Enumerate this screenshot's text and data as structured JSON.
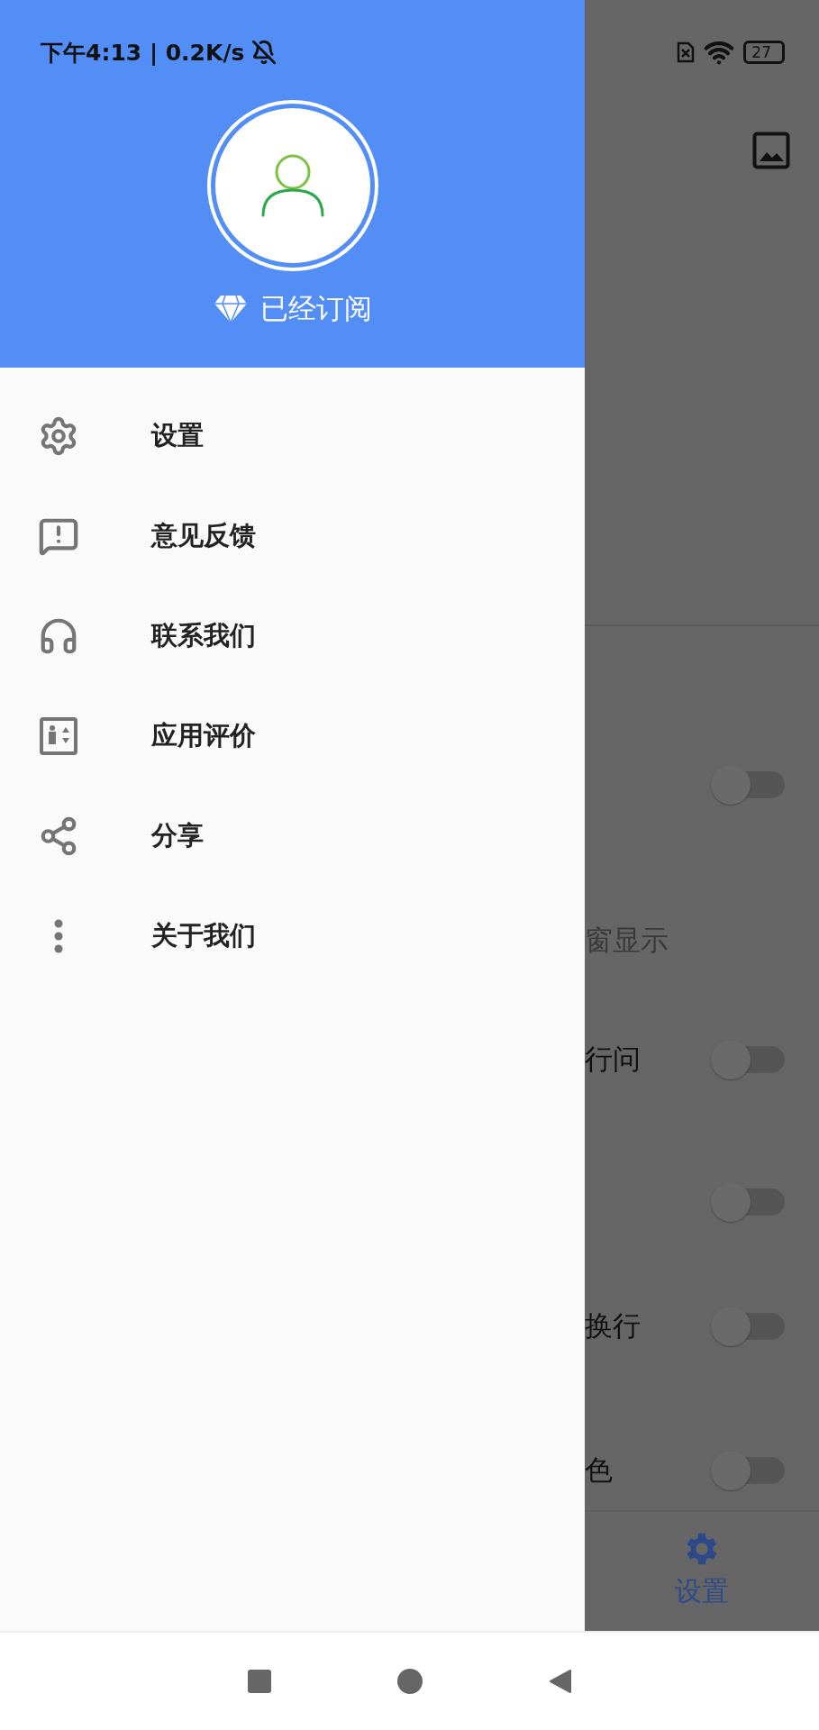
{
  "status_bar": {
    "time_and_speed": "下午4:13 | 0.2K/s",
    "battery": "27"
  },
  "drawer": {
    "subscription": "已经订阅",
    "items": [
      {
        "kind": "settings",
        "label": "设置"
      },
      {
        "kind": "feedback",
        "label": "意见反馈"
      },
      {
        "kind": "contact",
        "label": "联系我们"
      },
      {
        "kind": "rate",
        "label": "应用评价"
      },
      {
        "kind": "share",
        "label": "分享"
      },
      {
        "kind": "about",
        "label": "关于我们"
      }
    ]
  },
  "background_screen": {
    "rows": [
      {
        "kind": "toggle",
        "on": false
      },
      {
        "kind": "label",
        "text": "窗显示"
      },
      {
        "kind": "toggle",
        "text": "行问",
        "on": false
      },
      {
        "kind": "toggle",
        "on": false
      },
      {
        "kind": "toggle",
        "text": "换行",
        "on": false
      },
      {
        "kind": "toggle",
        "text": "色",
        "on": false
      }
    ],
    "bottom_nav": [
      {
        "label": "设置",
        "selected": true
      }
    ]
  }
}
